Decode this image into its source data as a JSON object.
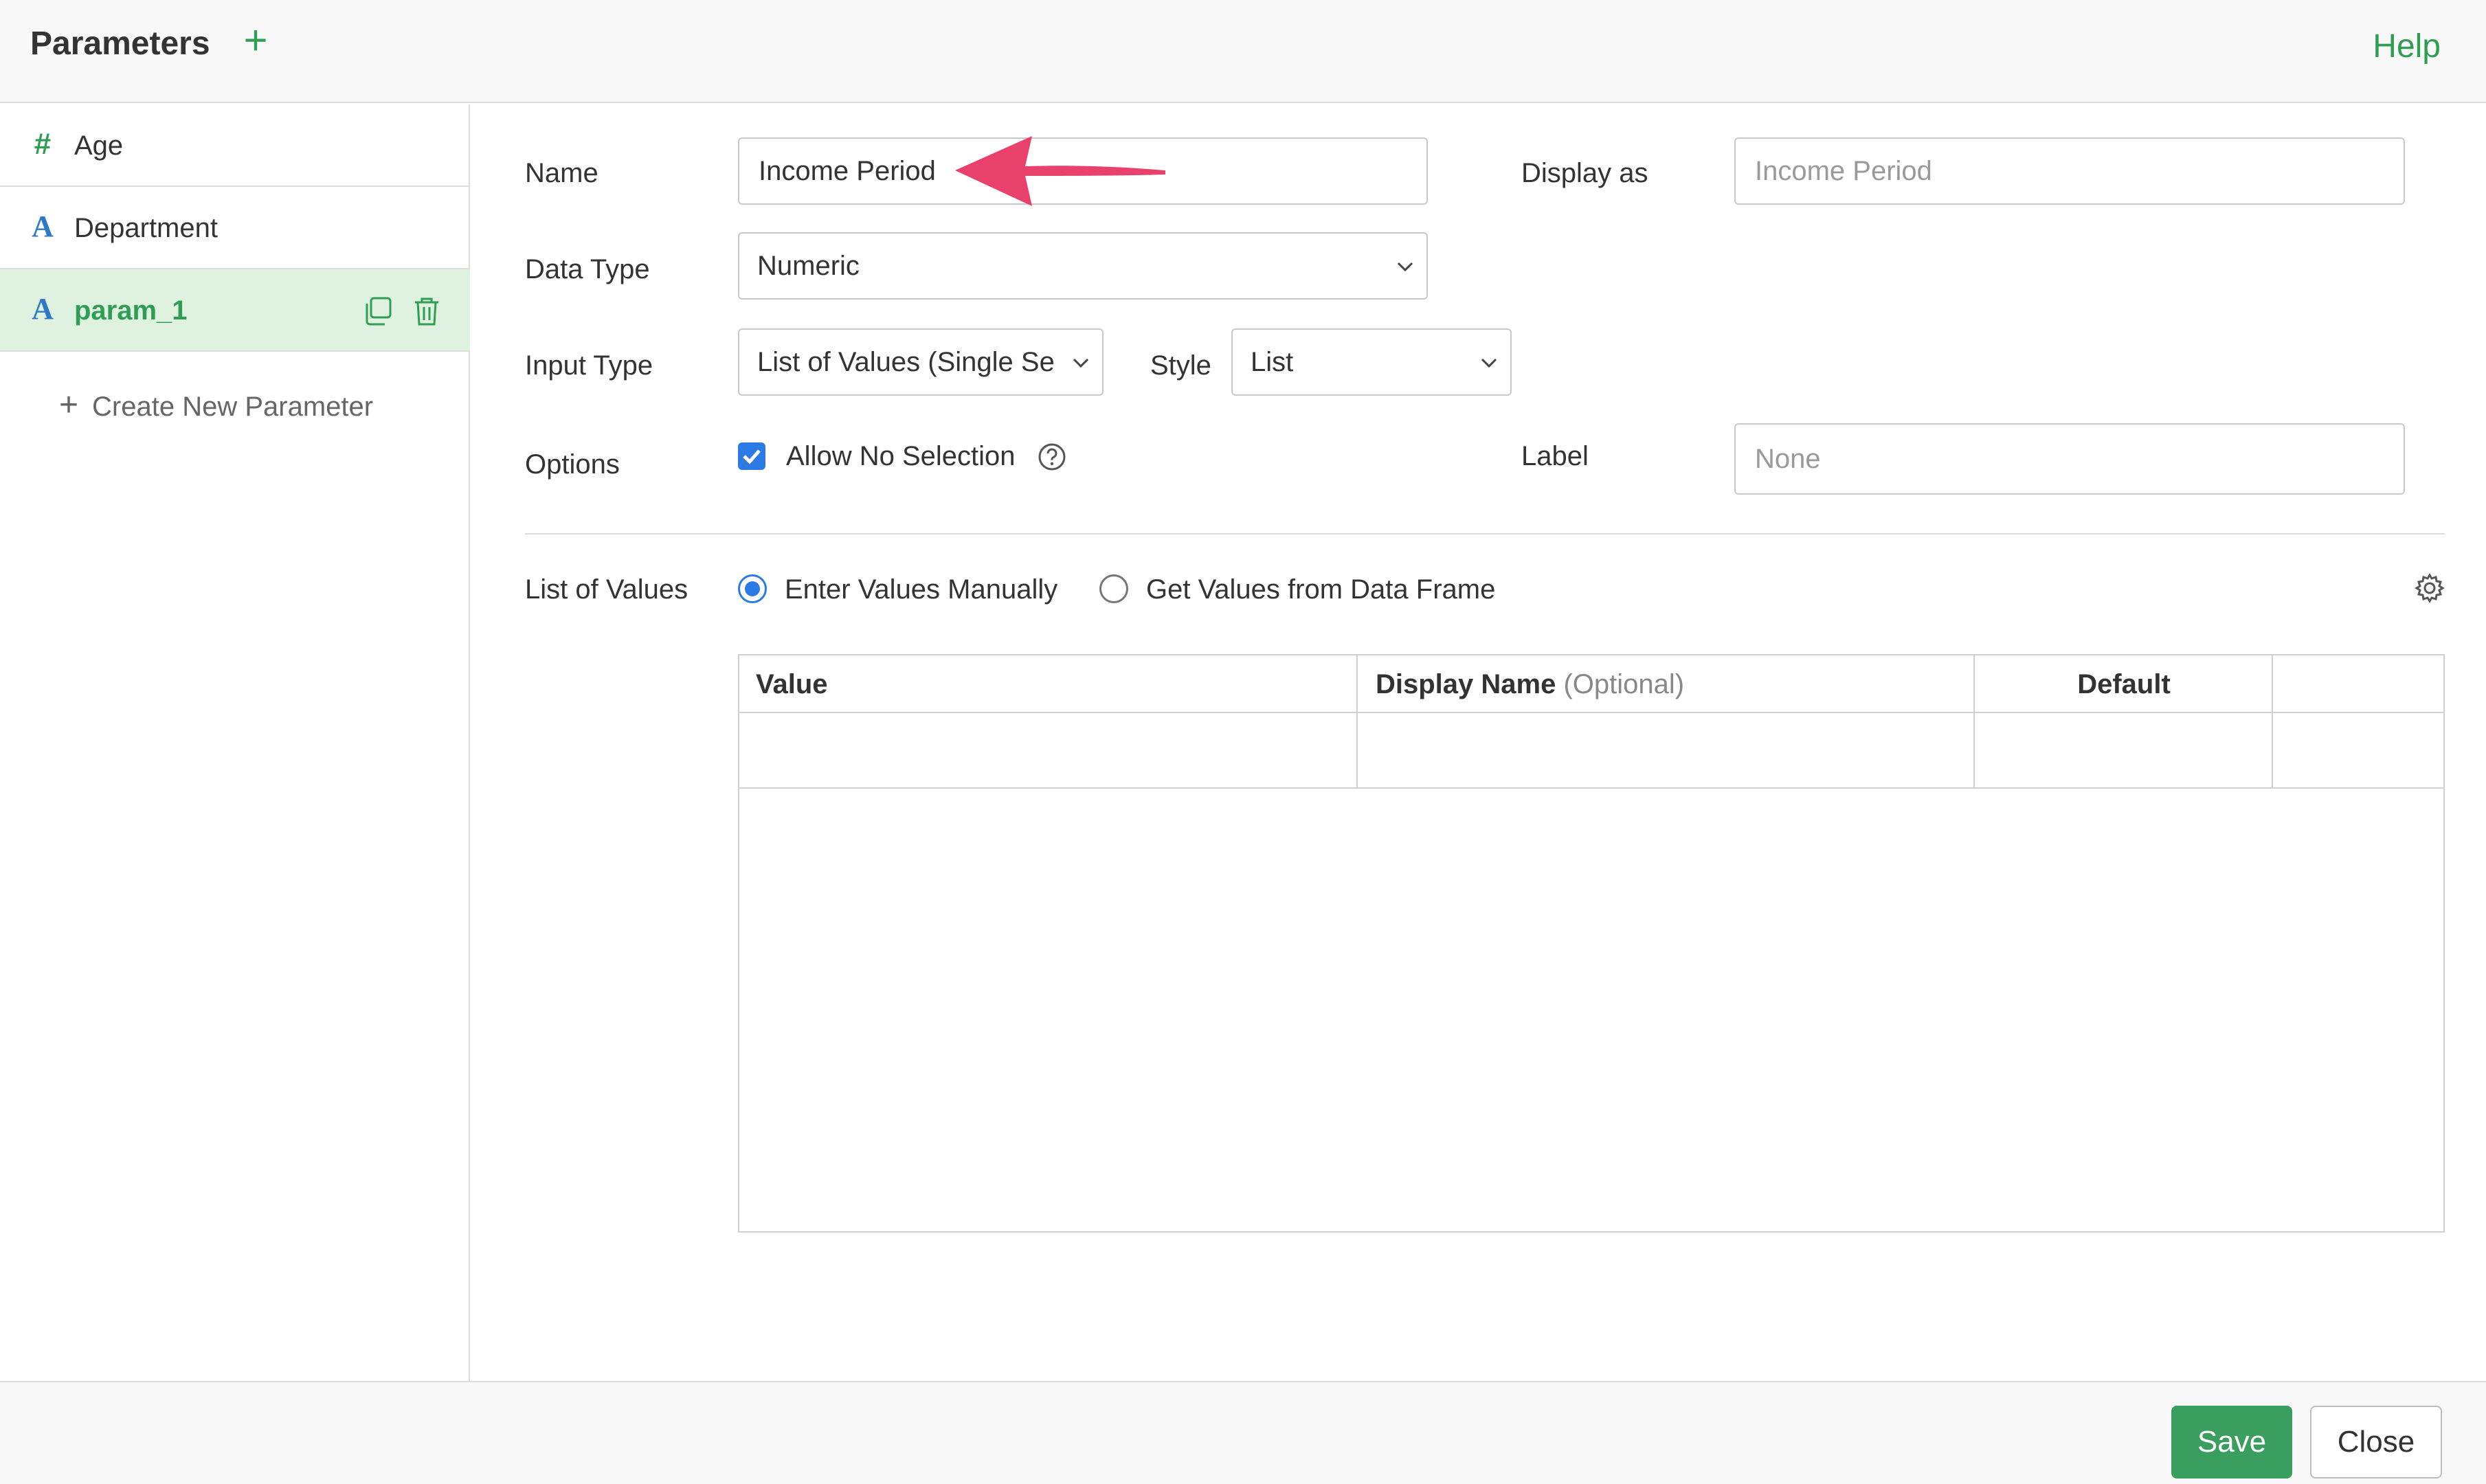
{
  "header": {
    "title": "Parameters",
    "add_symbol": "+",
    "help": "Help"
  },
  "sidebar": {
    "items": [
      {
        "type_icon": "#",
        "label": "Age",
        "icon_name": "number-type-icon"
      },
      {
        "type_icon": "A",
        "label": "Department",
        "icon_name": "text-type-icon"
      },
      {
        "type_icon": "A",
        "label": "param_1",
        "icon_name": "text-type-icon",
        "active": true
      }
    ],
    "create_new_symbol": "+",
    "create_new": "Create New Parameter"
  },
  "form": {
    "name_label": "Name",
    "name_value": "Income Period",
    "display_as_label": "Display as",
    "display_as_placeholder": "Income Period",
    "data_type_label": "Data Type",
    "data_type_value": "Numeric",
    "input_type_label": "Input Type",
    "input_type_value": "List of Values (Single Se",
    "style_label": "Style",
    "style_value": "List",
    "options_label": "Options",
    "allow_no_selection": "Allow No Selection",
    "allow_no_selection_checked": true,
    "label_label": "Label",
    "label_placeholder": "None",
    "list_of_values_label": "List of Values",
    "radio_manual": "Enter Values Manually",
    "radio_dataframe": "Get Values from Data Frame",
    "selected_source": "Enter Values Manually"
  },
  "table": {
    "columns": [
      {
        "label": "Value",
        "suffix": ""
      },
      {
        "label": "Display Name",
        "suffix": "(Optional)"
      },
      {
        "label": "Default",
        "suffix": ""
      },
      {
        "label": "",
        "suffix": ""
      }
    ]
  },
  "footer": {
    "save": "Save",
    "close": "Close"
  },
  "colors": {
    "accent_green": "#2f9e54",
    "active_row_bg": "#dff2df",
    "type_blue": "#2d79c7",
    "checkbox_blue": "#2c7be5",
    "annotation_arrow": "#e8416b"
  }
}
